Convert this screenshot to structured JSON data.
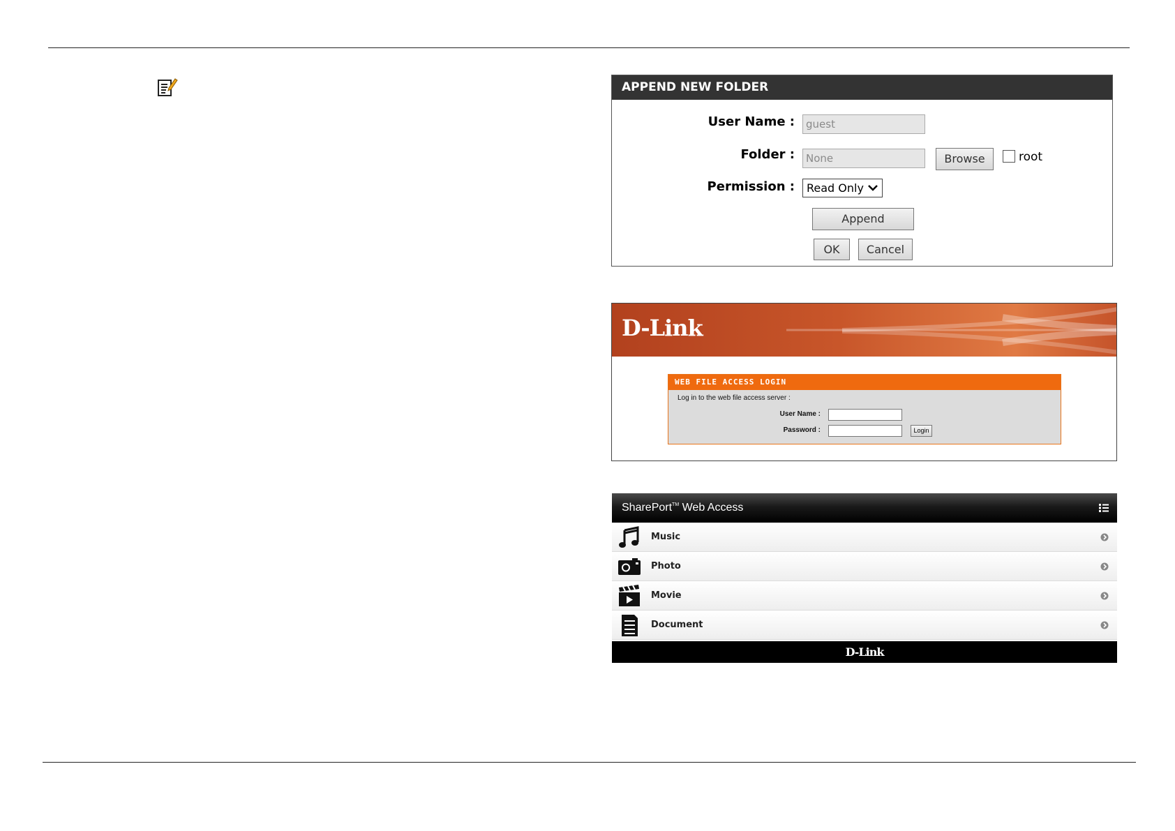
{
  "note_icon": "note-pencil-icon",
  "append_folder": {
    "title": "APPEND NEW FOLDER",
    "user_name_label": "User Name :",
    "user_name_value": "guest",
    "folder_label": "Folder :",
    "folder_value": "None",
    "browse_button": "Browse",
    "root_checkbox_label": "root",
    "root_checked": false,
    "permission_label": "Permission :",
    "permission_value": "Read Only",
    "append_button": "Append",
    "ok_button": "OK",
    "cancel_button": "Cancel"
  },
  "web_file_login": {
    "brand": "D-Link",
    "title": "WEB FILE ACCESS LOGIN",
    "intro": "Log in to the web file access server :",
    "user_name_label": "User Name :",
    "password_label": "Password :",
    "login_button": "Login"
  },
  "shareport": {
    "title": "SharePort",
    "trademark": "TM",
    "title_suffix": " Web Access",
    "menu_icon": "list-menu-icon",
    "items": [
      {
        "label": "Music",
        "icon": "music-note-icon"
      },
      {
        "label": "Photo",
        "icon": "camera-icon"
      },
      {
        "label": "Movie",
        "icon": "clapperboard-icon"
      },
      {
        "label": "Document",
        "icon": "document-icon"
      }
    ],
    "footer_brand": "D-Link"
  }
}
